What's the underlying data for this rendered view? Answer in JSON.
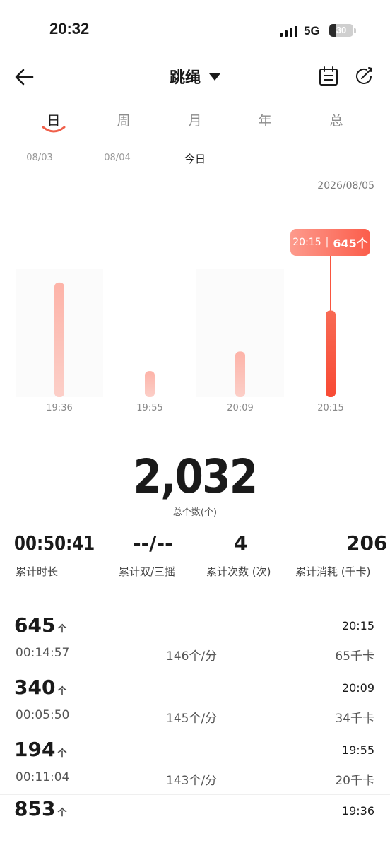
{
  "status_bar": {
    "time": "20:32",
    "network": "5G",
    "battery": "30",
    "battery_level": 0.3
  },
  "header": {
    "title": "跳绳",
    "back_icon": "arrow-left-icon",
    "calendar_icon": "calendar-icon",
    "share_icon": "share-icon"
  },
  "tabs": [
    {
      "label": "日",
      "active": true
    },
    {
      "label": "周",
      "active": false
    },
    {
      "label": "月",
      "active": false
    },
    {
      "label": "年",
      "active": false
    },
    {
      "label": "总",
      "active": false
    }
  ],
  "date_nav": {
    "dates": [
      "08/03",
      "08/04",
      "今日"
    ],
    "current_date": "2026/08/05"
  },
  "chart_data": {
    "type": "bar",
    "categories": [
      "19:36",
      "19:55",
      "20:09",
      "20:15"
    ],
    "values": [
      853,
      194,
      340,
      645
    ],
    "ylim": [
      0,
      1000
    ],
    "selected_index": 3,
    "tooltip": {
      "time": "20:15",
      "value": "645个"
    },
    "colors": {
      "bar": "#fcbfb6",
      "selected": "#f9553f",
      "grid": "#f4f4f4"
    }
  },
  "summary": {
    "total": "2,032",
    "total_label": "总个数(个)"
  },
  "stats": [
    {
      "value": "00:50:41",
      "label": "累计时长"
    },
    {
      "value": "--/--",
      "label": "累计双/三摇"
    },
    {
      "value": "4",
      "label": "累计次数 (次)"
    },
    {
      "value": "206",
      "label": "累计消耗 (千卡)"
    }
  ],
  "records": [
    {
      "count": "645",
      "unit": "个",
      "time": "20:15",
      "duration": "00:14:57",
      "rate": "146个/分",
      "calories": "65千卡"
    },
    {
      "count": "340",
      "unit": "个",
      "time": "20:09",
      "duration": "00:05:50",
      "rate": "145个/分",
      "calories": "34千卡"
    },
    {
      "count": "194",
      "unit": "个",
      "time": "19:55",
      "duration": "00:11:04",
      "rate": "143个/分",
      "calories": "20千卡"
    },
    {
      "count": "853",
      "unit": "个",
      "time": "19:36"
    }
  ]
}
